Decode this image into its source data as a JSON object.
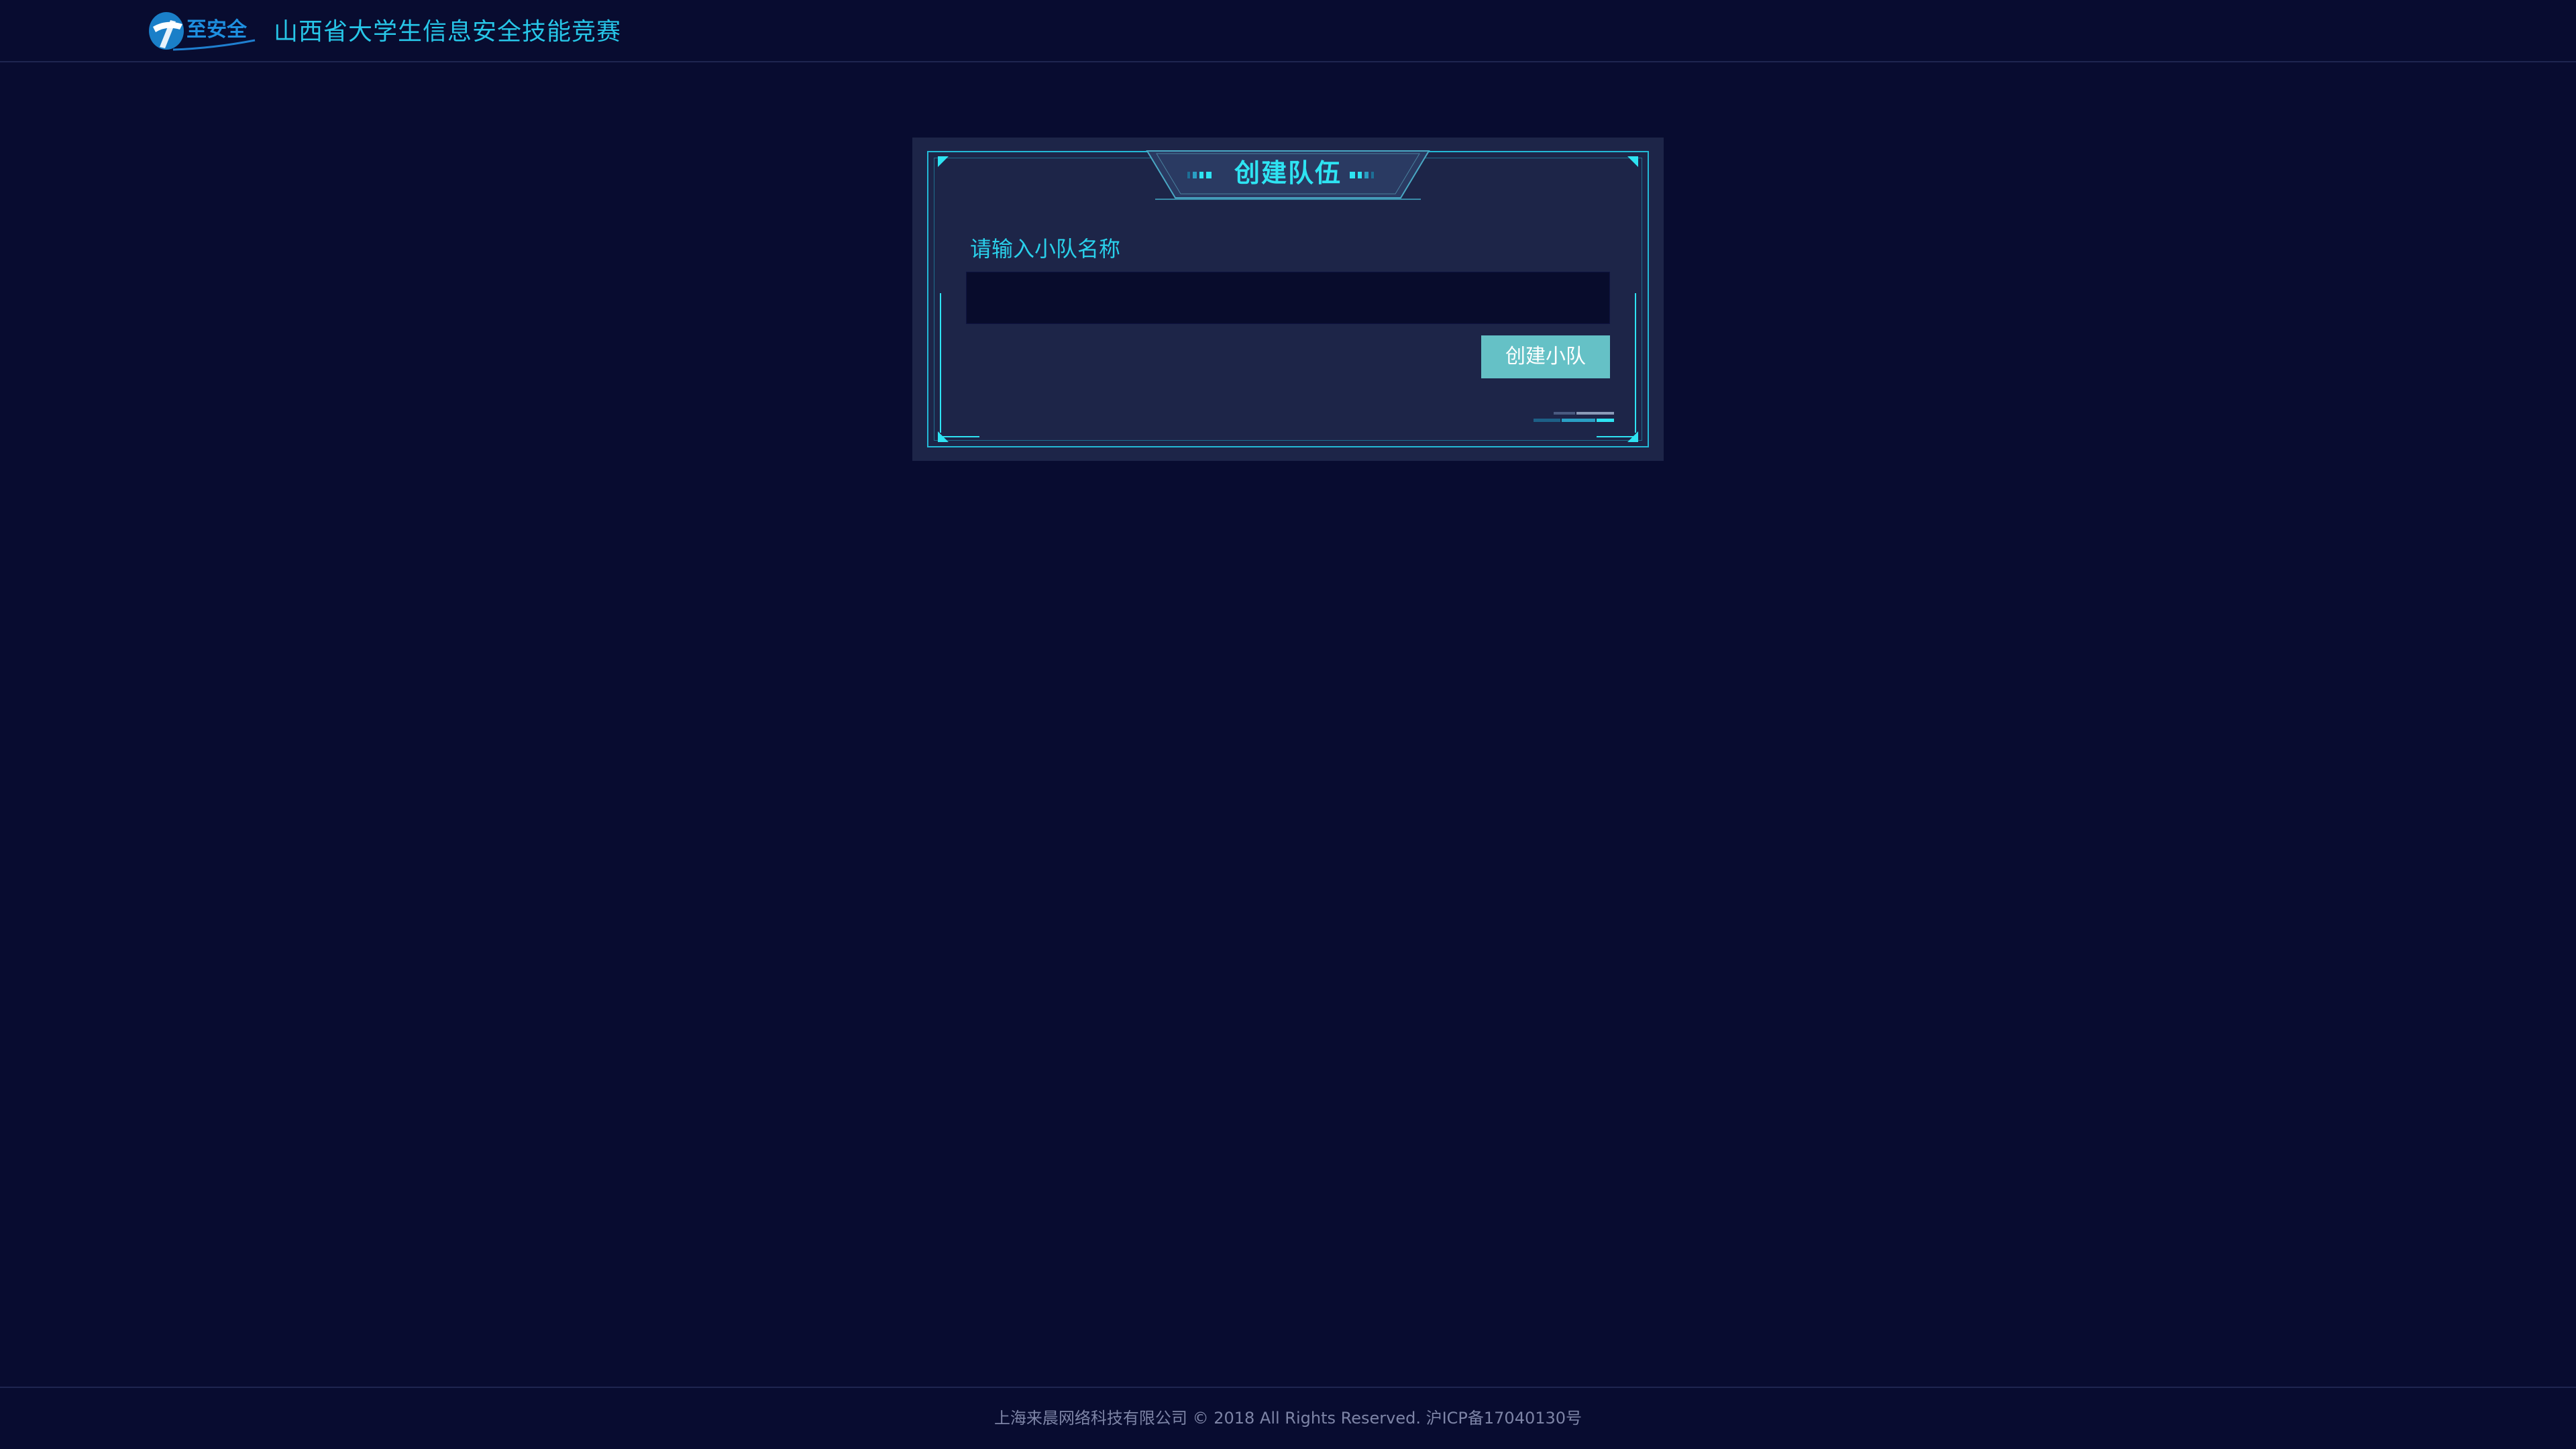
{
  "header": {
    "logo_text": "至安全",
    "title": "山西省大学生信息安全技能竞赛"
  },
  "panel": {
    "title": "创建队伍",
    "label": "请输入小队名称",
    "input_value": "",
    "input_placeholder": "",
    "button_label": "创建小队"
  },
  "footer": {
    "text": "上海来晨网络科技有限公司 © 2018 All Rights Reserved.  沪ICP备17040130号"
  },
  "colors": {
    "background": "#080c30",
    "panel": "#1d2548",
    "accent_cyan": "#27c6e8",
    "button": "#65c1c6"
  },
  "icons": {
    "logo": "zhianquan-logo"
  }
}
